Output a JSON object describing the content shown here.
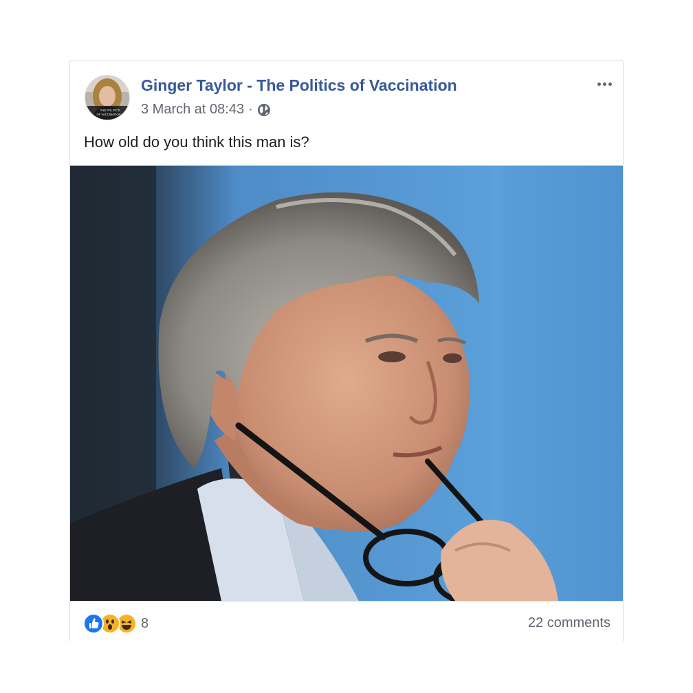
{
  "post": {
    "page_name": "Ginger Taylor - The Politics of Vaccination",
    "timestamp": "3 March at 08:43",
    "separator": "·",
    "privacy_icon": "globe-icon",
    "menu_icon": "more-options-icon",
    "text": "How old do you think this man is?",
    "avatar_caption": [
      "THE POLITICS",
      "OF VACCINATION"
    ],
    "photo_subject": "portrait-photo"
  },
  "reactions": {
    "icons": [
      "like-reaction-icon",
      "wow-reaction-icon",
      "haha-reaction-icon"
    ],
    "count": "8",
    "comments": "22 comments"
  },
  "colors": {
    "link": "#385898",
    "meta": "#606770",
    "like": "#1877f2",
    "emoji": "#f7b125"
  }
}
